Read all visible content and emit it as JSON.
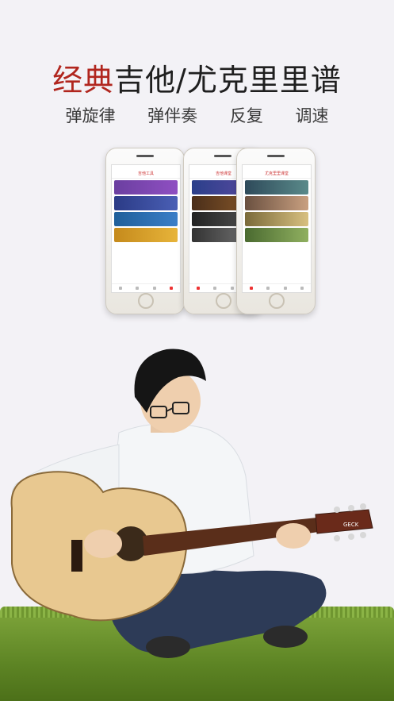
{
  "headline": {
    "accent": "经典",
    "rest": "吉他/尤克里里谱"
  },
  "features": [
    "弹旋律",
    "弹伴奏",
    "反复",
    "调速"
  ],
  "phones": [
    {
      "title": "吉他工具"
    },
    {
      "title": "吉他课堂"
    },
    {
      "title": "尤克里里课堂"
    }
  ],
  "guitar_brand": "GECK"
}
